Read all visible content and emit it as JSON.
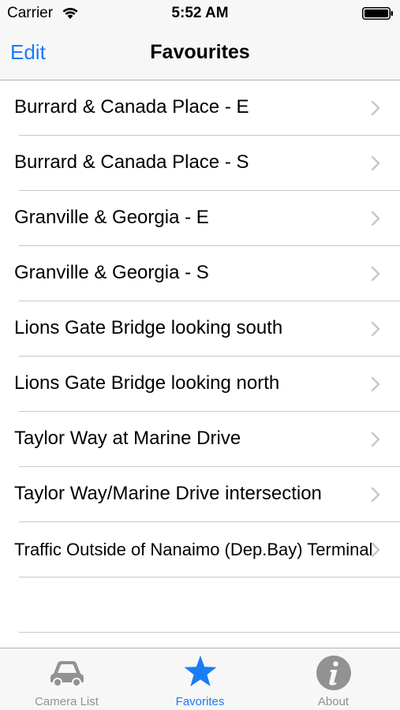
{
  "status_bar": {
    "carrier": "Carrier",
    "time": "5:52 AM"
  },
  "nav_bar": {
    "edit_label": "Edit",
    "title": "Favourites"
  },
  "favourites": [
    {
      "label": "Burrard & Canada Place - E"
    },
    {
      "label": "Burrard & Canada Place - S"
    },
    {
      "label": "Granville & Georgia - E"
    },
    {
      "label": "Granville & Georgia - S"
    },
    {
      "label": "Lions Gate Bridge looking south"
    },
    {
      "label": "Lions Gate Bridge looking north"
    },
    {
      "label": "Taylor Way at Marine Drive"
    },
    {
      "label": "Taylor Way/Marine Drive intersection"
    },
    {
      "label": "Traffic Outside of Nanaimo (Dep.Bay) Terminal"
    }
  ],
  "tab_bar": {
    "tabs": [
      {
        "label": "Camera List",
        "icon": "car-icon",
        "active": false
      },
      {
        "label": "Favorites",
        "icon": "star-icon",
        "active": true
      },
      {
        "label": "About",
        "icon": "info-icon",
        "active": false
      }
    ]
  },
  "colors": {
    "accent": "#1a7cf7",
    "inactive": "#929292",
    "separator": "#c8c7cc",
    "bar_background": "#f7f7f7"
  }
}
